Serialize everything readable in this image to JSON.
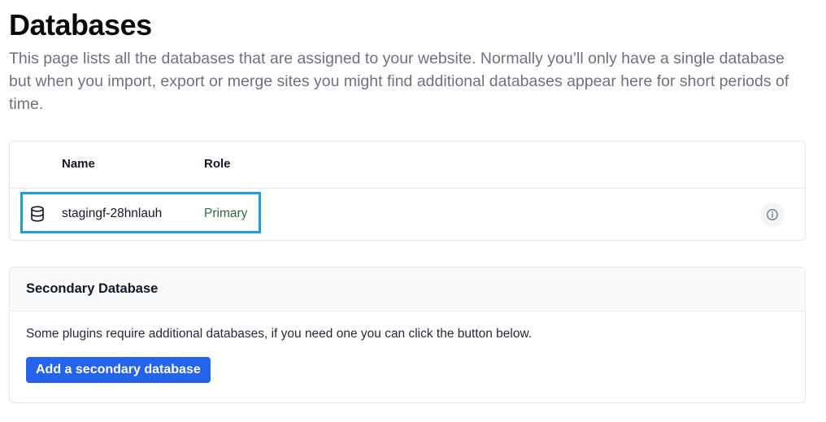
{
  "page": {
    "title": "Databases",
    "description": "This page lists all the databases that are assigned to your website. Normally you’ll only have a single database but when you import, export or merge sites you might find additional databases appear here for short periods of time."
  },
  "databases_table": {
    "columns": {
      "name": "Name",
      "role": "Role"
    },
    "rows": [
      {
        "icon": "database-icon",
        "name": "stagingf-28hnlauh",
        "role": "Primary",
        "action_icon": "info-icon"
      }
    ],
    "highlight_color": "#1aa0dd",
    "role_color": "#2f6b3a"
  },
  "secondary": {
    "title": "Secondary Database",
    "text": "Some plugins require additional databases, if you need one you can click the button below.",
    "button_label": "Add a secondary database",
    "button_color": "#2563eb"
  }
}
